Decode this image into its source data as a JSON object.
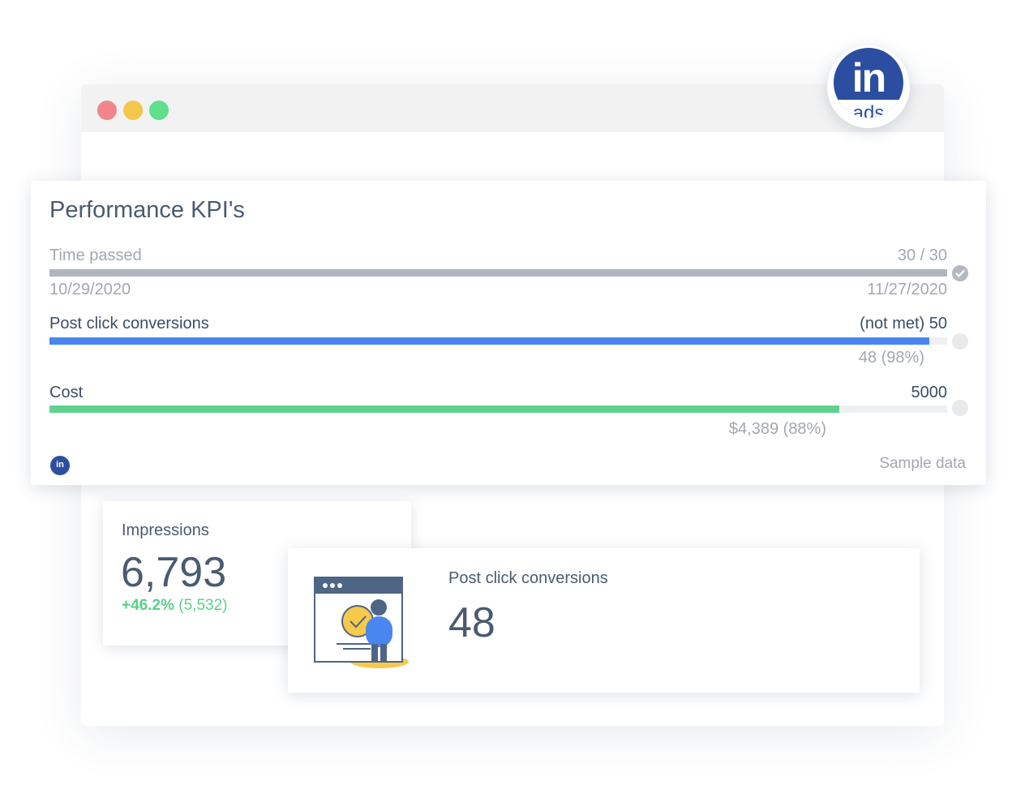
{
  "window": {
    "traffic_lights": [
      {
        "name": "close",
        "color": "#f0868b"
      },
      {
        "name": "minimize",
        "color": "#f4c64a"
      },
      {
        "name": "maximize",
        "color": "#5ee08d"
      }
    ]
  },
  "logo": {
    "in_text": "in",
    "ads_text": "ads",
    "color": "#2c4ea0"
  },
  "kpi": {
    "title": "Performance KPI's",
    "time_passed": {
      "label": "Time passed",
      "value": "30 / 30",
      "start_date": "10/29/2020",
      "end_date": "11/27/2020",
      "progress": 1.0,
      "color": "#b0b5bd",
      "status": "check-circle-icon"
    },
    "post_click": {
      "label": "Post click conversions",
      "target": "(not met) 50",
      "current": "48 (98%)",
      "progress": 0.98,
      "color": "#4a86f0",
      "status": "empty-circle-icon"
    },
    "cost": {
      "label": "Cost",
      "target": "5000",
      "current": "$4,389 (88%)",
      "progress": 0.88,
      "color": "#5fd38e",
      "status": "empty-circle-icon"
    },
    "small_logo_text": "in",
    "sample_note": "Sample data"
  },
  "impressions": {
    "label": "Impressions",
    "value": "6,793",
    "delta": "+46.2%",
    "previous": "(5,532)"
  },
  "post_click_card": {
    "label": "Post click conversions",
    "value": "48",
    "illustration": "person-browser-check-illustration"
  }
}
